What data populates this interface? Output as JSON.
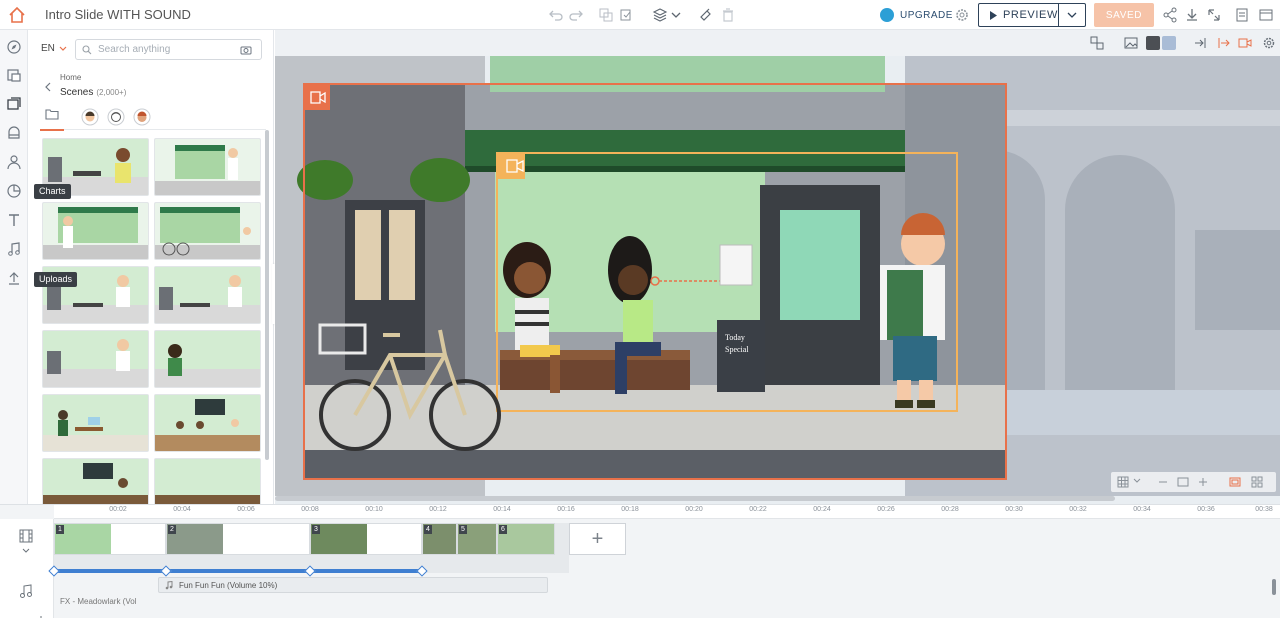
{
  "app": {
    "title": "Intro Slide WITH SOUND"
  },
  "toolbar": {
    "upgrade_label": "UPGRADE",
    "preview_label": "PREVIEW",
    "saved_label": "SAVED",
    "icons": [
      "undo-icon",
      "redo-icon",
      "copy-icon",
      "paste-icon",
      "layers-icon",
      "clean-icon",
      "delete-icon",
      "gear-icon",
      "share-icon",
      "download-icon",
      "resize-icon",
      "notes-icon",
      "help-icon"
    ]
  },
  "rail": {
    "items": [
      "explore-icon",
      "templates-icon",
      "scenes-icon",
      "props-icon",
      "characters-icon",
      "charts-icon",
      "text-icon",
      "music-icon",
      "uploads-icon"
    ],
    "tooltips": {
      "charts": "Charts",
      "uploads": "Uploads"
    }
  },
  "library": {
    "language": "EN",
    "search_placeholder": "Search anything",
    "breadcrumb_home": "Home",
    "section_title": "Scenes",
    "section_count": "(2,000+)"
  },
  "timeline": {
    "ruler_labels": [
      "00:02",
      "00:04",
      "00:06",
      "00:08",
      "00:10",
      "00:12",
      "00:14",
      "00:16",
      "00:18",
      "00:20",
      "00:22",
      "00:24",
      "00:26",
      "00:28",
      "00:30",
      "00:32",
      "00:34",
      "00:36",
      "00:38"
    ],
    "scene_numbers": [
      "1",
      "2",
      "3",
      "4",
      "5",
      "6"
    ],
    "audio_track_label": "Fun Fun Fun (Volume 10%)",
    "audio_track2_label": "FX - Meadowlark (Vol"
  },
  "colors": {
    "accent": "#e8714a",
    "navy": "#2e4259",
    "saved_bg": "#f6c3a8",
    "timeline_blue": "#3f7fd1"
  }
}
